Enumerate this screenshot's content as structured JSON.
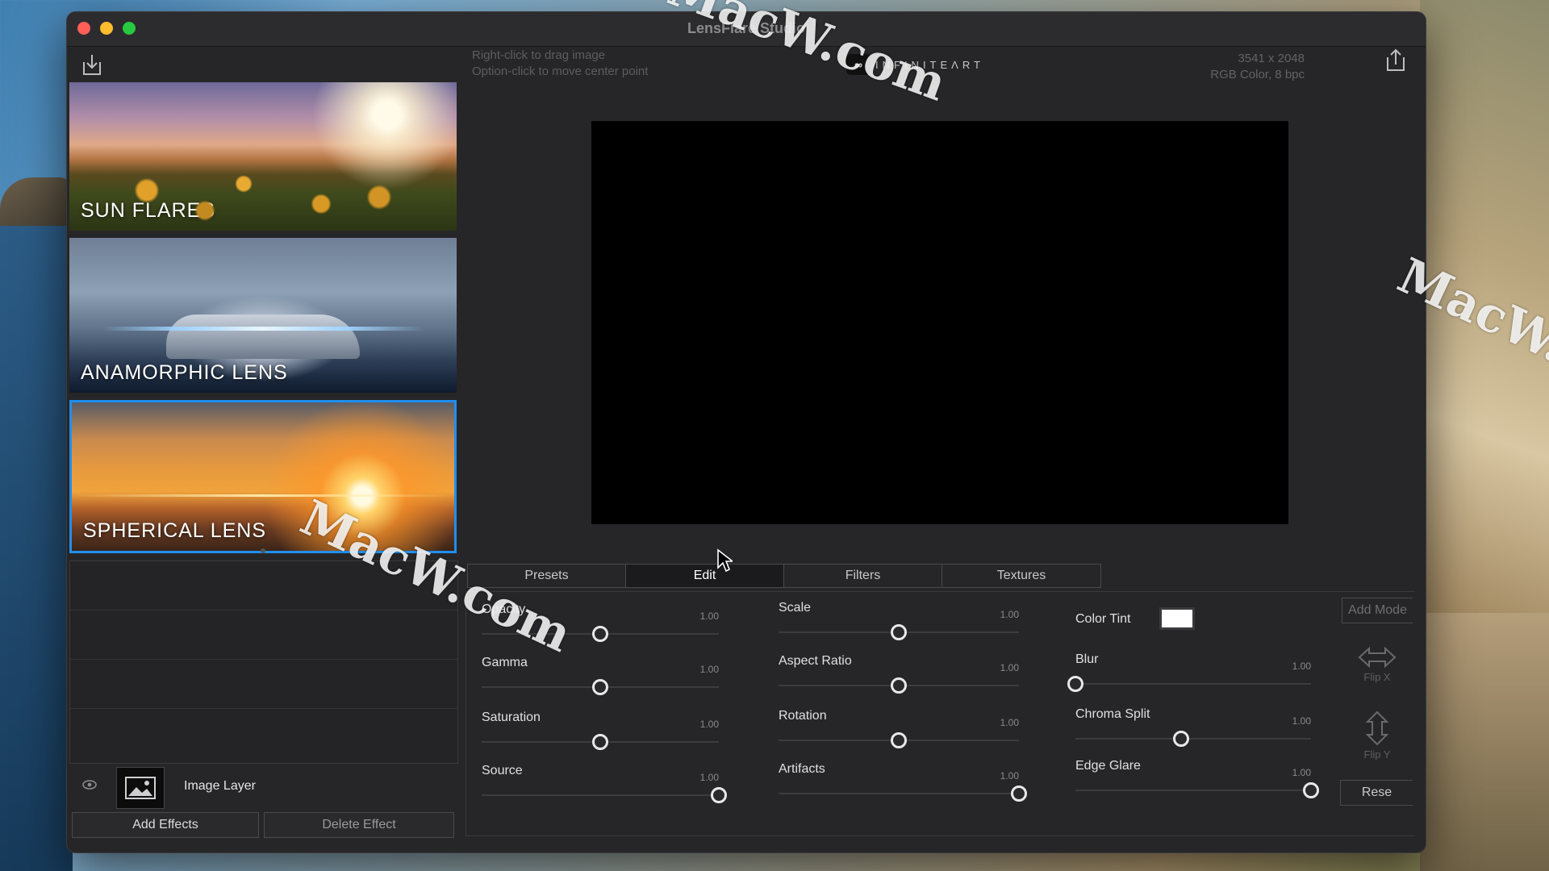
{
  "window": {
    "title": "LensFlare Studio"
  },
  "hint": {
    "line1": "Right-click to drag image",
    "line2": "Option-click to move center point"
  },
  "logo": {
    "mark": "∞",
    "text": "INFINITEΛRT"
  },
  "image_info": {
    "size": "3541 x 2048",
    "mode": "RGB Color, 8 bpc"
  },
  "categories": [
    {
      "label": "SUN FLARES"
    },
    {
      "label": "ANAMORPHIC LENS"
    },
    {
      "label": "SPHERICAL LENS"
    }
  ],
  "layer": {
    "name": "Image Layer"
  },
  "buttons": {
    "add_effects": "Add Effects",
    "delete_effect": "Delete Effect",
    "add_mode": "Add Mode",
    "reset": "Rese"
  },
  "tabs": [
    {
      "label": "Presets"
    },
    {
      "label": "Edit"
    },
    {
      "label": "Filters"
    },
    {
      "label": "Textures"
    }
  ],
  "params": {
    "col1": [
      {
        "label": "Opacity",
        "value": "1.00",
        "level": 0.5
      },
      {
        "label": "Gamma",
        "value": "1.00",
        "level": 0.5
      },
      {
        "label": "Saturation",
        "value": "1.00",
        "level": 0.5
      },
      {
        "label": "Source",
        "value": "1.00",
        "level": 1.0
      }
    ],
    "col2": [
      {
        "label": "Scale",
        "value": "1.00",
        "level": 0.5
      },
      {
        "label": "Aspect Ratio",
        "value": "1.00",
        "level": 0.5
      },
      {
        "label": "Rotation",
        "value": "1.00",
        "level": 0.5
      },
      {
        "label": "Artifacts",
        "value": "1.00",
        "level": 1.0
      }
    ],
    "col3": [
      {
        "label": "Blur",
        "value": "1.00",
        "level": 0.0
      },
      {
        "label": "Chroma Split",
        "value": "1.00",
        "level": 0.45
      },
      {
        "label": "Edge Glare",
        "value": "1.00",
        "level": 1.0
      }
    ]
  },
  "color_tint": {
    "label": "Color Tint",
    "color": "#ffffff"
  },
  "flip": {
    "x": "Flip X",
    "y": "Flip Y"
  },
  "watermark": "MacW.com"
}
